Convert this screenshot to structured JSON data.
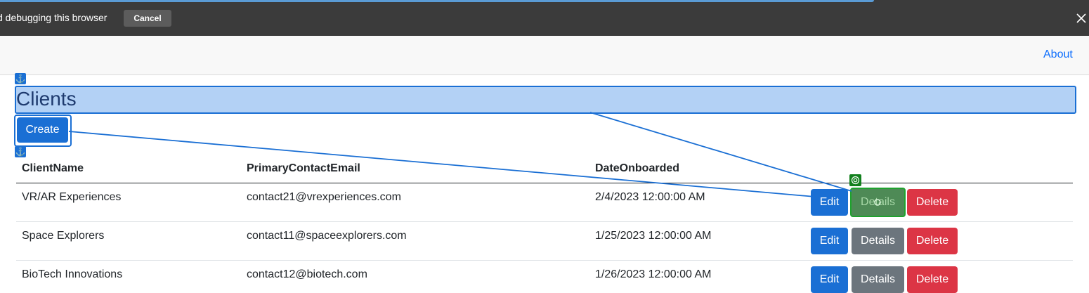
{
  "debug_bar": {
    "message": "d debugging this browser",
    "cancel_label": "Cancel"
  },
  "navbar": {
    "about_label": "About"
  },
  "page": {
    "title": "Clients",
    "create_label": "Create"
  },
  "table": {
    "columns": [
      "ClientName",
      "PrimaryContactEmail",
      "DateOnboarded"
    ],
    "rows": [
      {
        "name": "VR/AR Experiences",
        "email": "contact21@vrexperiences.com",
        "date": "2/4/2023 12:00:00 AM"
      },
      {
        "name": "Space Explorers",
        "email": "contact11@spaceexplorers.com",
        "date": "1/25/2023 12:00:00 AM"
      },
      {
        "name": "BioTech Innovations",
        "email": "contact12@biotech.com",
        "date": "1/26/2023 12:00:00 AM"
      }
    ],
    "actions": {
      "edit_label": "Edit",
      "details_label": "Details",
      "delete_label": "Delete"
    }
  },
  "colors": {
    "primary": "#1a6fd4",
    "secondary": "#6c757d",
    "danger": "#dc3545",
    "highlight": "#b3d1f5",
    "target": "#12801d"
  },
  "icons": {
    "anchor": "anchor-icon",
    "target": "target-icon",
    "close": "close-icon"
  }
}
